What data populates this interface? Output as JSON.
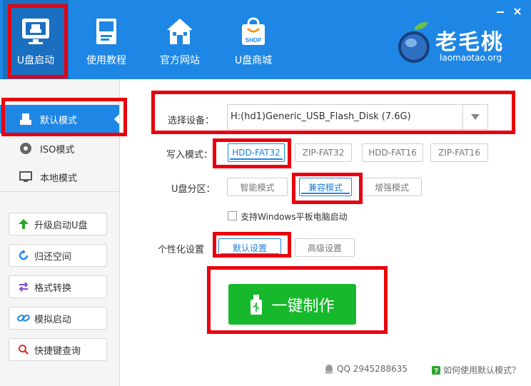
{
  "header": {
    "nav": [
      {
        "label": "U盘启动",
        "icon": "usb-drive-icon"
      },
      {
        "label": "使用教程",
        "icon": "book-icon"
      },
      {
        "label": "官方网站",
        "icon": "home-icon"
      },
      {
        "label": "U盘商城",
        "icon": "shop-bag-icon"
      }
    ],
    "shop_tag": "SHOP",
    "logo": {
      "title": "老毛桃",
      "subtitle": "laomaotao.org"
    }
  },
  "sidebar": {
    "modes": [
      {
        "label": "默认模式",
        "icon": "usb-icon",
        "active": true
      },
      {
        "label": "ISO模式",
        "icon": "disc-icon",
        "active": false
      },
      {
        "label": "本地模式",
        "icon": "monitor-icon",
        "active": false
      }
    ],
    "tools": [
      {
        "label": "升级启动U盘",
        "icon": "up-arrow-icon"
      },
      {
        "label": "归还空间",
        "icon": "refresh-icon"
      },
      {
        "label": "格式转换",
        "icon": "swap-icon"
      },
      {
        "label": "模拟启动",
        "icon": "link-icon"
      },
      {
        "label": "快捷键查询",
        "icon": "search-icon"
      }
    ]
  },
  "main": {
    "device_label": "选择设备：",
    "device_value": "H:(hd1)Generic_USB_Flash_Disk (7.6G)",
    "write_mode_label": "写入模式：",
    "write_modes": [
      "HDD-FAT32",
      "ZIP-FAT32",
      "HDD-FAT16",
      "ZIP-FAT16"
    ],
    "write_mode_selected": "HDD-FAT32",
    "partition_label": "U盘分区：",
    "partition_modes": [
      "智能模式",
      "兼容模式",
      "增强模式"
    ],
    "partition_selected": "兼容模式",
    "tablet_checkbox_label": "支持Windows平板电脑启动",
    "tablet_checked": false,
    "personalize_label": "个性化设置",
    "default_settings": "默认设置",
    "advanced_settings": "高级设置",
    "make_button": "一键制作"
  },
  "footer": {
    "qq": "QQ 2945288635",
    "help": "如何使用默认模式？"
  },
  "colors": {
    "brand_blue": "#1e87e5",
    "highlight_red": "#e8000d",
    "make_green": "#17b82b"
  }
}
